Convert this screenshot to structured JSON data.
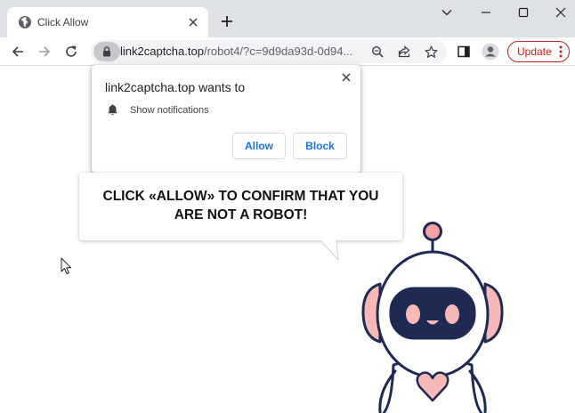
{
  "browser": {
    "tab": {
      "title": "Click Allow",
      "favicon": "globe-icon"
    },
    "new_tab_icon": "plus-icon",
    "window_controls": [
      "chevron-down-icon",
      "minimize-icon",
      "maximize-icon",
      "close-icon"
    ],
    "toolbar": {
      "nav_icons": [
        "back-arrow-icon",
        "forward-arrow-icon",
        "reload-icon"
      ],
      "url_host": "link2captcha.top",
      "url_path": "/robot4/?c=9d9da93d-0d94...",
      "omnibox_icons": [
        "zoom-icon",
        "share-icon",
        "star-icon"
      ],
      "extra_icons": [
        "side-panel-icon",
        "profile-icon"
      ],
      "update_label": "Update",
      "accent_color": "#c5221f"
    }
  },
  "permission_popup": {
    "title": "link2captcha.top wants to",
    "permission": "Show notifications",
    "allow_label": "Allow",
    "block_label": "Block",
    "button_color": "#1a73e8"
  },
  "page": {
    "message": "CLICK «ALLOW» TO CONFIRM THAT YOU ARE NOT A ROBOT!",
    "robot_colors": {
      "outline": "#1f2a52",
      "accent": "#f7b8b8",
      "antenna": "#f3a3a3"
    }
  }
}
